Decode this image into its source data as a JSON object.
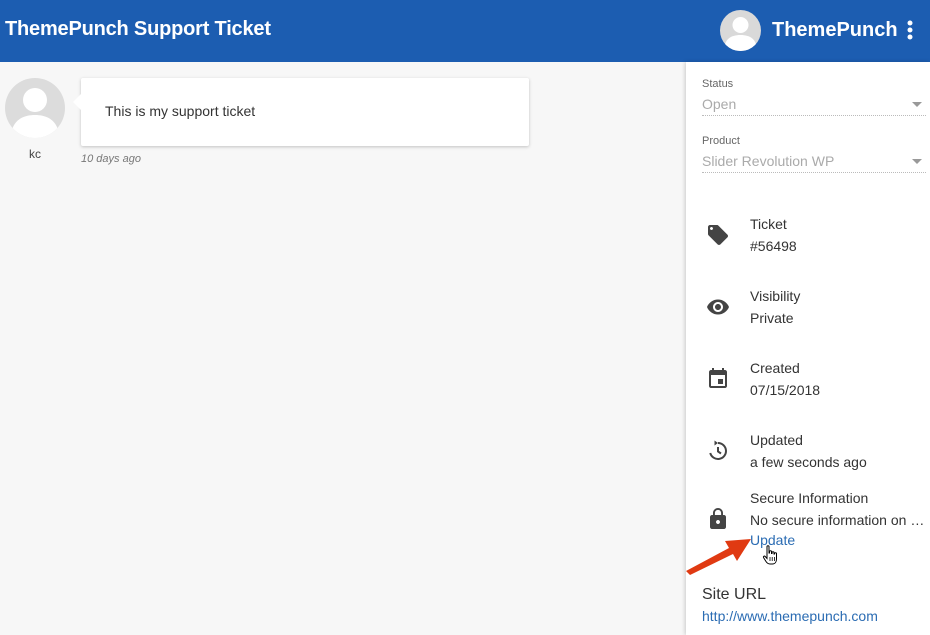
{
  "header": {
    "title": "ThemePunch Support Ticket",
    "user_name": "ThemePunch"
  },
  "message": {
    "author": "kc",
    "text": "This is my support ticket",
    "time": "10 days ago"
  },
  "sidebar": {
    "status": {
      "label": "Status",
      "value": "Open"
    },
    "product": {
      "label": "Product",
      "value": "Slider Revolution WP"
    },
    "ticket": {
      "title": "Ticket",
      "value": "#56498",
      "icon": "tag-icon"
    },
    "visibility": {
      "title": "Visibility",
      "value": "Private",
      "icon": "eye-icon"
    },
    "created": {
      "title": "Created",
      "value": "07/15/2018",
      "icon": "calendar-icon"
    },
    "updated": {
      "title": "Updated",
      "value": "a few seconds ago",
      "icon": "history-icon"
    },
    "secure": {
      "title": "Secure Information",
      "value": "No secure information on this ticket",
      "icon": "lock-icon",
      "link": "Update"
    },
    "site": {
      "title": "Site URL",
      "url": "http://www.themepunch.com"
    }
  },
  "colors": {
    "header_bg": "#1c5db1",
    "link": "#2b6cb3",
    "annotation_arrow": "#e03a12"
  }
}
